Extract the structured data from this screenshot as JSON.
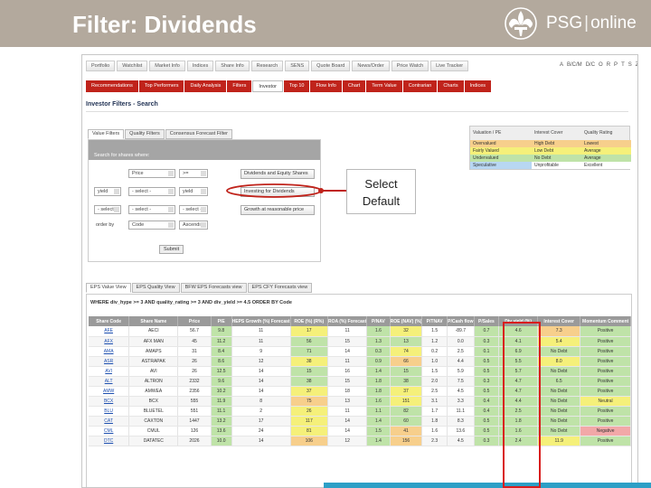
{
  "slide": {
    "title": "Filter: Dividends"
  },
  "logo": {
    "brand": "PSG",
    "suffix": "online"
  },
  "top_nav": [
    "Portfolio",
    "Watchlist",
    "Market Info",
    "Indices",
    "Share Info",
    "Research",
    "SENS",
    "Quote Board",
    "News/Order",
    "Price Watch",
    "Live Tracker"
  ],
  "alpha_nav": [
    "A",
    "B/C/M",
    "D/C",
    "O",
    "R",
    "P",
    "T",
    "S",
    "Z"
  ],
  "sub_nav": [
    {
      "label": "Recommendations",
      "active": false
    },
    {
      "label": "Top Performers",
      "active": false
    },
    {
      "label": "Daily Analysis",
      "active": false
    },
    {
      "label": "Filters",
      "active": false
    },
    {
      "label": "Investor",
      "active": true
    },
    {
      "label": "Top 10",
      "active": false
    },
    {
      "label": "Flow Info",
      "active": false
    },
    {
      "label": "Chart",
      "active": false
    },
    {
      "label": "Term Value",
      "active": false
    },
    {
      "label": "Contrarian",
      "active": false
    },
    {
      "label": "Charts",
      "active": false
    },
    {
      "label": "Indices",
      "active": false
    }
  ],
  "section_title": "Investor Filters - Search",
  "filter_tabs": [
    {
      "label": "Value Filters",
      "active": true
    },
    {
      "label": "Quality Filters",
      "active": false
    },
    {
      "label": "Consensus Forecast Filter",
      "active": false
    }
  ],
  "filter_panel": {
    "heading": "Search for shares where:",
    "row1": {
      "field": "Price",
      "op": ">=",
      "btn": "Dividends and Equity Shares"
    },
    "row2": {
      "a": "yield",
      "b": "- select -",
      "c": "yield",
      "btn": "Investing for Dividends"
    },
    "row3": {
      "a": "- select -",
      "b": "- select -",
      "c": "- select -",
      "btn": "Growth at reasonable price"
    },
    "order_label": "order by",
    "order_field": "Code",
    "order_dir": "Ascending",
    "submit": "Submit"
  },
  "legend": {
    "headers": [
      "Valuation / PE",
      "Interest Cover",
      "Quality Rating"
    ],
    "rows": [
      {
        "cells": [
          "Overvalued",
          "High Debt",
          "Lowest"
        ],
        "colors": [
          "#f7cf8c",
          "#f7cf8c",
          "#f7cf8c"
        ]
      },
      {
        "cells": [
          "Fairly Valued",
          "Low Debt",
          "Average"
        ],
        "colors": [
          "#f5f07a",
          "#f5f07a",
          "#f5f07a"
        ]
      },
      {
        "cells": [
          "Undervalued",
          "No Debt",
          "Average"
        ],
        "colors": [
          "#bfe3a8",
          "#bfe3a8",
          "#bfe3a8"
        ]
      },
      {
        "cells": [
          "Speculative",
          "Unprofitable",
          "Excellent"
        ],
        "colors": [
          "#b8d7f2",
          "#ffffff",
          "#ffffff"
        ]
      }
    ]
  },
  "callout": {
    "line1": "Select",
    "line2": "Default"
  },
  "result_tabs": [
    {
      "label": "EPS Value View",
      "active": true
    },
    {
      "label": "EPS Quality View",
      "active": false
    },
    {
      "label": "BFW EPS Forecasts view",
      "active": false
    },
    {
      "label": "EPS CFY Forecasts view",
      "active": false
    }
  ],
  "query_text": "WHERE div_hype >= 3 AND quality_rating >= 3 AND div_yield >= 4.5 ORDER BY Code",
  "table": {
    "headers": [
      "Share Code",
      "Share Name",
      "Price",
      "P/E",
      "HEPS Growth (%) Forecast",
      "ROE (%) (R%)",
      "ROA (%) Forecast",
      "P/NAV",
      "ROE (NAV) (%)",
      "P/TNAV",
      "P/Cash flow",
      "P/Sales",
      "Div yield (%)",
      "Interest Cover",
      "Momentum Comment"
    ],
    "rows": [
      [
        "AFE",
        "AECI",
        "56.7",
        "9.8",
        "11",
        "17",
        "11",
        "1.6",
        "32",
        "1.5",
        "-89.7",
        "0.7",
        "4.6",
        "7.3",
        "Positive"
      ],
      [
        "AFX",
        "AFX MAN",
        "45",
        "11.2",
        "11",
        "56",
        "15",
        "1.3",
        "13",
        "1.2",
        "0.0",
        "0.3",
        "4.1",
        "5.4",
        "Positive"
      ],
      [
        "AMA",
        "AMAPS",
        "31",
        "8.4",
        "9",
        "71",
        "14",
        "0.3",
        "74",
        "0.2",
        "2.5",
        "0.1",
        "6.9",
        "No Debt",
        "Positive"
      ],
      [
        "ASR",
        "ASTRAPAK",
        "26",
        "8.6",
        "12",
        "38",
        "11",
        "0.9",
        "66",
        "1.0",
        "4.4",
        "0.5",
        "5.5",
        "8.0",
        "Positive"
      ],
      [
        "AVI",
        "AVI",
        "26",
        "12.5",
        "14",
        "15",
        "16",
        "1.4",
        "15",
        "1.5",
        "5.9",
        "0.5",
        "5.7",
        "No Debt",
        "Positive"
      ],
      [
        "ALT",
        "ALTRON",
        "2332",
        "9.6",
        "14",
        "38",
        "15",
        "1.8",
        "38",
        "2.0",
        "7.5",
        "0.3",
        "4.7",
        "6.5",
        "Positive"
      ],
      [
        "AMW",
        "AMWEA",
        "2356",
        "10.2",
        "14",
        "37",
        "18",
        "1.8",
        "37",
        "2.5",
        "4.5",
        "0.5",
        "4.7",
        "No Debt",
        "Positive"
      ],
      [
        "BCX",
        "BCX",
        "555",
        "11.9",
        "8",
        "75",
        "13",
        "1.6",
        "151",
        "3.1",
        "3.3",
        "0.4",
        "4.4",
        "No Debt",
        "Neutral"
      ],
      [
        "BLU",
        "BLUETEL",
        "551",
        "11.1",
        "2",
        "26",
        "11",
        "1.1",
        "82",
        "1.7",
        "11.1",
        "0.4",
        "2.5",
        "No Debt",
        "Positive"
      ],
      [
        "CAT",
        "CAXTON",
        "1447",
        "13.2",
        "17",
        "117",
        "14",
        "1.4",
        "60",
        "1.8",
        "8.3",
        "0.5",
        "1.8",
        "No Debt",
        "Positive"
      ],
      [
        "CML",
        "CMUL",
        "126",
        "13.6",
        "24",
        "81",
        "14",
        "1.5",
        "41",
        "1.6",
        "13.6",
        "0.5",
        "1.6",
        "No Debt",
        "Negative"
      ],
      [
        "DTC",
        "DATATEC",
        "2026",
        "10.0",
        "14",
        "106",
        "12",
        "1.4",
        "156",
        "2.3",
        "4.5",
        "0.3",
        "2.4",
        "11.9",
        "Positive"
      ]
    ],
    "cell_colors": [
      [
        "",
        "",
        "",
        "g",
        "",
        "y",
        "",
        "g",
        "y",
        "",
        "",
        "g",
        "g",
        "o",
        "g"
      ],
      [
        "",
        "",
        "",
        "g",
        "",
        "g",
        "",
        "g",
        "g",
        "",
        "",
        "g",
        "g",
        "y",
        "g"
      ],
      [
        "",
        "",
        "",
        "g",
        "",
        "g",
        "",
        "g",
        "y",
        "",
        "",
        "g",
        "g",
        "g",
        "g"
      ],
      [
        "",
        "",
        "",
        "g",
        "",
        "y",
        "",
        "g",
        "o",
        "",
        "",
        "g",
        "g",
        "y",
        "g"
      ],
      [
        "",
        "",
        "",
        "g",
        "",
        "g",
        "",
        "g",
        "g",
        "",
        "",
        "g",
        "g",
        "g",
        "g"
      ],
      [
        "",
        "",
        "",
        "g",
        "",
        "g",
        "",
        "g",
        "g",
        "",
        "",
        "g",
        "g",
        "g",
        "g"
      ],
      [
        "",
        "",
        "",
        "g",
        "",
        "y",
        "",
        "g",
        "y",
        "",
        "",
        "g",
        "g",
        "g",
        "g"
      ],
      [
        "",
        "",
        "",
        "g",
        "",
        "o",
        "",
        "g",
        "y",
        "",
        "",
        "g",
        "g",
        "g",
        "y"
      ],
      [
        "",
        "",
        "",
        "g",
        "",
        "y",
        "",
        "g",
        "g",
        "",
        "",
        "g",
        "g",
        "g",
        "g"
      ],
      [
        "",
        "",
        "",
        "g",
        "",
        "y",
        "",
        "g",
        "g",
        "",
        "",
        "g",
        "g",
        "g",
        "g"
      ],
      [
        "",
        "",
        "",
        "g",
        "",
        "y",
        "",
        "g",
        "o",
        "",
        "",
        "g",
        "g",
        "g",
        "r"
      ],
      [
        "",
        "",
        "",
        "g",
        "",
        "o",
        "",
        "g",
        "o",
        "",
        "",
        "g",
        "g",
        "y",
        "g"
      ]
    ]
  },
  "colors": {
    "header_bg": "#b3a99d",
    "nav_red": "#c0231b",
    "highlight": "#d91d1d",
    "accent_bar": "#2c9fc6"
  }
}
